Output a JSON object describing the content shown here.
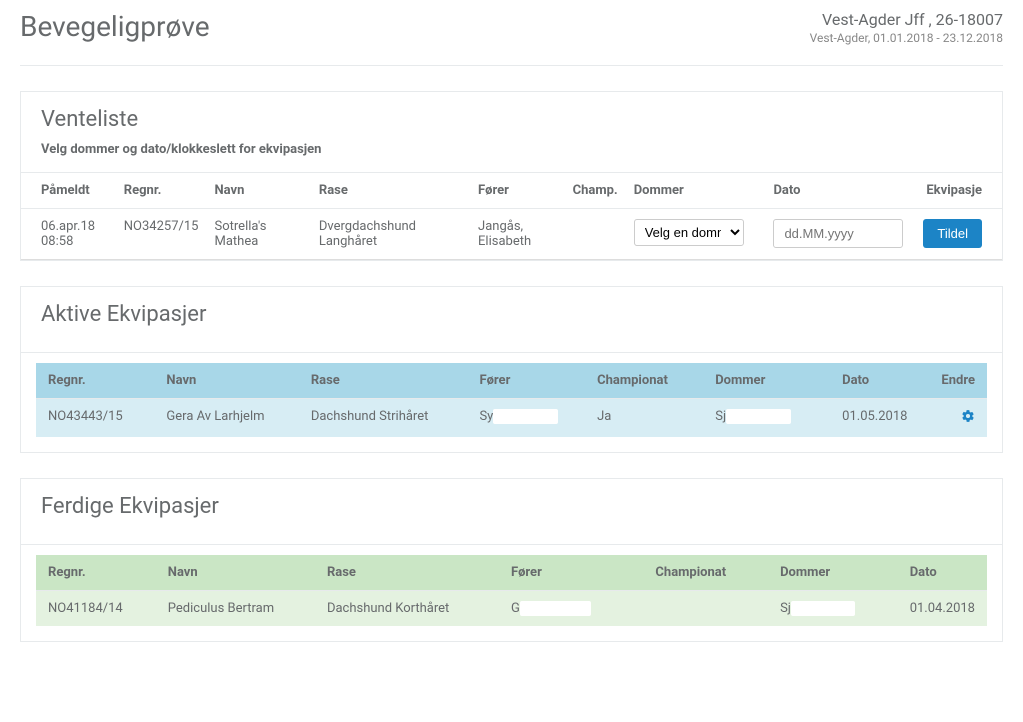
{
  "header": {
    "title": "Bevegeligprøve",
    "org": "Vest-Agder Jff , 26-18007",
    "dates": "Vest-Agder, 01.01.2018 - 23.12.2018"
  },
  "venteliste": {
    "title": "Venteliste",
    "subtitle": "Velg dommer og dato/klokkeslett for ekvipasjen",
    "columns": {
      "pameldt": "Påmeldt",
      "regnr": "Regnr.",
      "navn": "Navn",
      "rase": "Rase",
      "forer": "Fører",
      "champ": "Champ.",
      "dommer": "Dommer",
      "dato": "Dato",
      "ekvipasje": "Ekvipasje"
    },
    "rows": [
      {
        "pameldt_line1": "06.apr.18",
        "pameldt_line2": "08:58",
        "regnr": "NO34257/15",
        "navn_line1": "Sotrella's",
        "navn_line2": "Mathea",
        "rase_line1": "Dvergdachshund",
        "rase_line2": "Langhåret",
        "forer_line1": "Jangås,",
        "forer_line2": "Elisabeth",
        "dommer_placeholder": "Velg en dommer",
        "dato_placeholder": "dd.MM.yyyy",
        "assign_label": "Tildel"
      }
    ]
  },
  "aktive": {
    "title": "Aktive Ekvipasjer",
    "columns": {
      "regnr": "Regnr.",
      "navn": "Navn",
      "rase": "Rase",
      "forer": "Fører",
      "champ": "Championat",
      "dommer": "Dommer",
      "dato": "Dato",
      "endre": "Endre"
    },
    "rows": [
      {
        "regnr": "NO43443/15",
        "navn": "Gera Av Larhjelm",
        "rase": "Dachshund Strihåret",
        "forer_prefix": "Sy",
        "forer_redacted": "xxxxxxxxxx",
        "champ": "Ja",
        "dommer_prefix": "Sj",
        "dommer_redacted": "xxxxxxxxxx",
        "dato": "01.05.2018"
      }
    ]
  },
  "ferdige": {
    "title": "Ferdige Ekvipasjer",
    "columns": {
      "regnr": "Regnr.",
      "navn": "Navn",
      "rase": "Rase",
      "forer": "Fører",
      "champ": "Championat",
      "dommer": "Dommer",
      "dato": "Dato"
    },
    "rows": [
      {
        "regnr": "NO41184/14",
        "navn": "Pediculus Bertram",
        "rase": "Dachshund Korthåret",
        "forer_prefix": "G",
        "forer_redacted": "xxxxxxxxxxx",
        "champ": "",
        "dommer_prefix": "Sj",
        "dommer_redacted": "xxxxxxxxxx",
        "dato": "01.04.2018"
      }
    ]
  }
}
